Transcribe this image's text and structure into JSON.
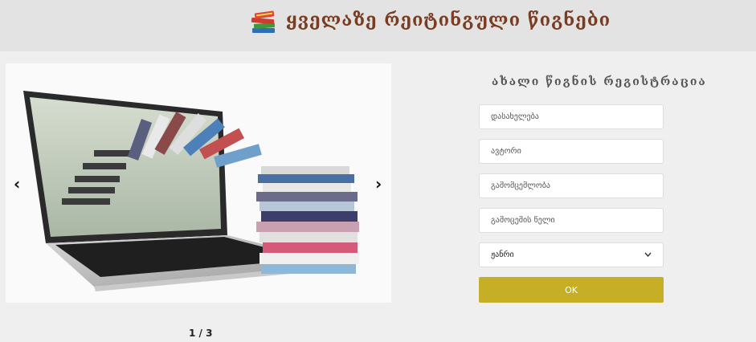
{
  "header": {
    "title": "ყველაზე რეიტინგული წიგნები",
    "logo_icon": "book-stack-icon"
  },
  "slider": {
    "prev_label": "‹",
    "next_label": "›",
    "counter": "1 / 3"
  },
  "form": {
    "title": "ახალი წიგნის რეგისტრაცია",
    "fields": [
      {
        "placeholder": "დასახელება",
        "value": ""
      },
      {
        "placeholder": "ავტორი",
        "value": ""
      },
      {
        "placeholder": "გამომცემლობა",
        "value": ""
      },
      {
        "placeholder": "გამოცემის წელი",
        "value": ""
      }
    ],
    "genre_select": {
      "selected": "ჟანრი",
      "icon": "chevron-down-icon"
    },
    "submit_label": "OK",
    "accent_color": "#c6af27"
  }
}
